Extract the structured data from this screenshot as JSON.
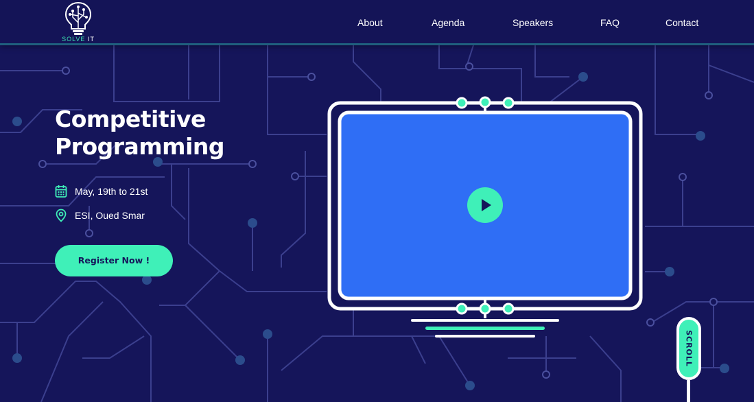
{
  "logo": {
    "brand": "SOLVE",
    "suffix": "IT"
  },
  "nav": {
    "items": [
      {
        "label": "About"
      },
      {
        "label": "Agenda"
      },
      {
        "label": "Speakers"
      },
      {
        "label": "FAQ"
      },
      {
        "label": "Contact"
      }
    ]
  },
  "hero": {
    "title_line1": "Competitive",
    "title_line2": "Programming",
    "date": "May, 19th to 21st",
    "location": "ESI, Oued Smar",
    "register_label": "Register Now !"
  },
  "scroll": {
    "label": "SCROLL"
  },
  "icons": {
    "logo": "lightbulb-circuit-icon",
    "date": "calendar-icon",
    "location": "location-pin-icon",
    "video": "play-icon"
  },
  "colors": {
    "background": "#15155a",
    "accent": "#3ff0b8",
    "screen": "#2f6ef5",
    "circuit": "#3a3f8f",
    "text": "#ffffff"
  }
}
